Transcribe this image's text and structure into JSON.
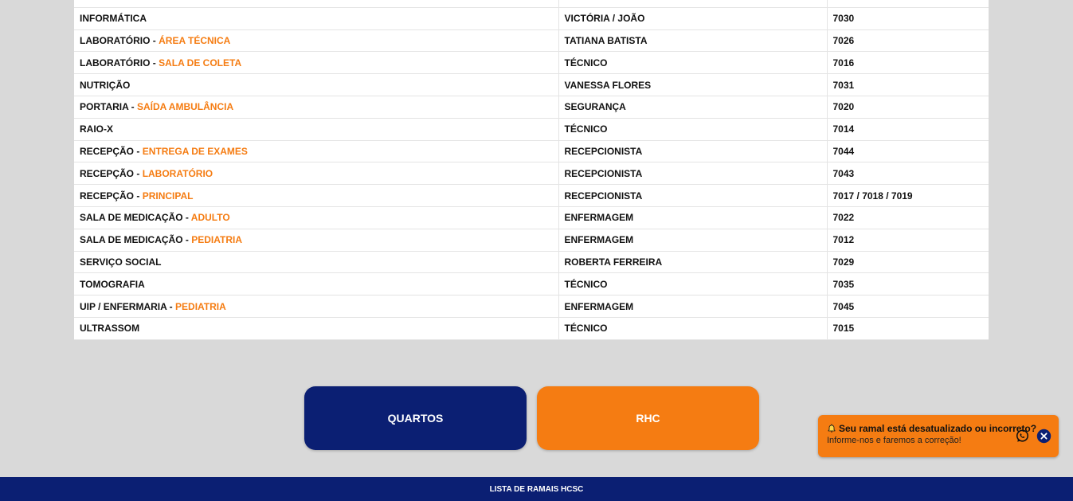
{
  "table": {
    "rows": [
      {
        "sector": "",
        "sub": "",
        "contact": "",
        "ramal": ""
      },
      {
        "sector": "INFORMÁTICA",
        "sub": "",
        "contact": "VICTÓRIA / JOÃO",
        "ramal": "7030"
      },
      {
        "sector": "LABORATÓRIO",
        "sub": "ÁREA TÉCNICA",
        "contact": "TATIANA BATISTA",
        "ramal": "7026"
      },
      {
        "sector": "LABORATÓRIO",
        "sub": "SALA DE COLETA",
        "contact": "TÉCNICO",
        "ramal": "7016"
      },
      {
        "sector": "NUTRIÇÃO",
        "sub": "",
        "contact": "VANESSA FLORES",
        "ramal": "7031"
      },
      {
        "sector": "PORTARIA",
        "sub": "SAÍDA AMBULÂNCIA",
        "contact": "SEGURANÇA",
        "ramal": "7020"
      },
      {
        "sector": "RAIO-X",
        "sub": "",
        "contact": "TÉCNICO",
        "ramal": "7014"
      },
      {
        "sector": "RECEPÇÃO",
        "sub": "ENTREGA DE EXAMES",
        "contact": "RECEPCIONISTA",
        "ramal": "7044"
      },
      {
        "sector": "RECEPÇÃO",
        "sub": "LABORATÓRIO",
        "contact": "RECEPCIONISTA",
        "ramal": "7043"
      },
      {
        "sector": "RECEPÇÃO",
        "sub": "PRINCIPAL",
        "contact": "RECEPCIONISTA",
        "ramal": "7017 / 7018 / 7019"
      },
      {
        "sector": "SALA DE MEDICAÇÃO",
        "sub": "ADULTO",
        "contact": "ENFERMAGEM",
        "ramal": "7022"
      },
      {
        "sector": "SALA DE MEDICAÇÃO",
        "sub": "PEDIATRIA",
        "contact": "ENFERMAGEM",
        "ramal": "7012"
      },
      {
        "sector": "SERVIÇO SOCIAL",
        "sub": "",
        "contact": "ROBERTA FERREIRA",
        "ramal": "7029"
      },
      {
        "sector": "TOMOGRAFIA",
        "sub": "",
        "contact": "TÉCNICO",
        "ramal": "7035"
      },
      {
        "sector": "UIP / ENFERMARIA",
        "sub": "PEDIATRIA",
        "contact": "ENFERMAGEM",
        "ramal": "7045"
      },
      {
        "sector": "ULTRASSOM",
        "sub": "",
        "contact": "TÉCNICO",
        "ramal": "7015"
      }
    ]
  },
  "buttons": {
    "quartos": "QUARTOS",
    "rhc": "RHC"
  },
  "notice": {
    "title": "Seu ramal está desatualizado ou incorreto?",
    "subtitle": "Informe-nos e faremos a correção!",
    "icons": [
      "bell-icon",
      "whatsapp-icon",
      "close-icon"
    ]
  },
  "footer": {
    "text": "LISTA DE RAMAIS HCSC"
  },
  "colors": {
    "navy": "#0b1f73",
    "orange": "#f57c12",
    "background": "#d9d9d9"
  }
}
